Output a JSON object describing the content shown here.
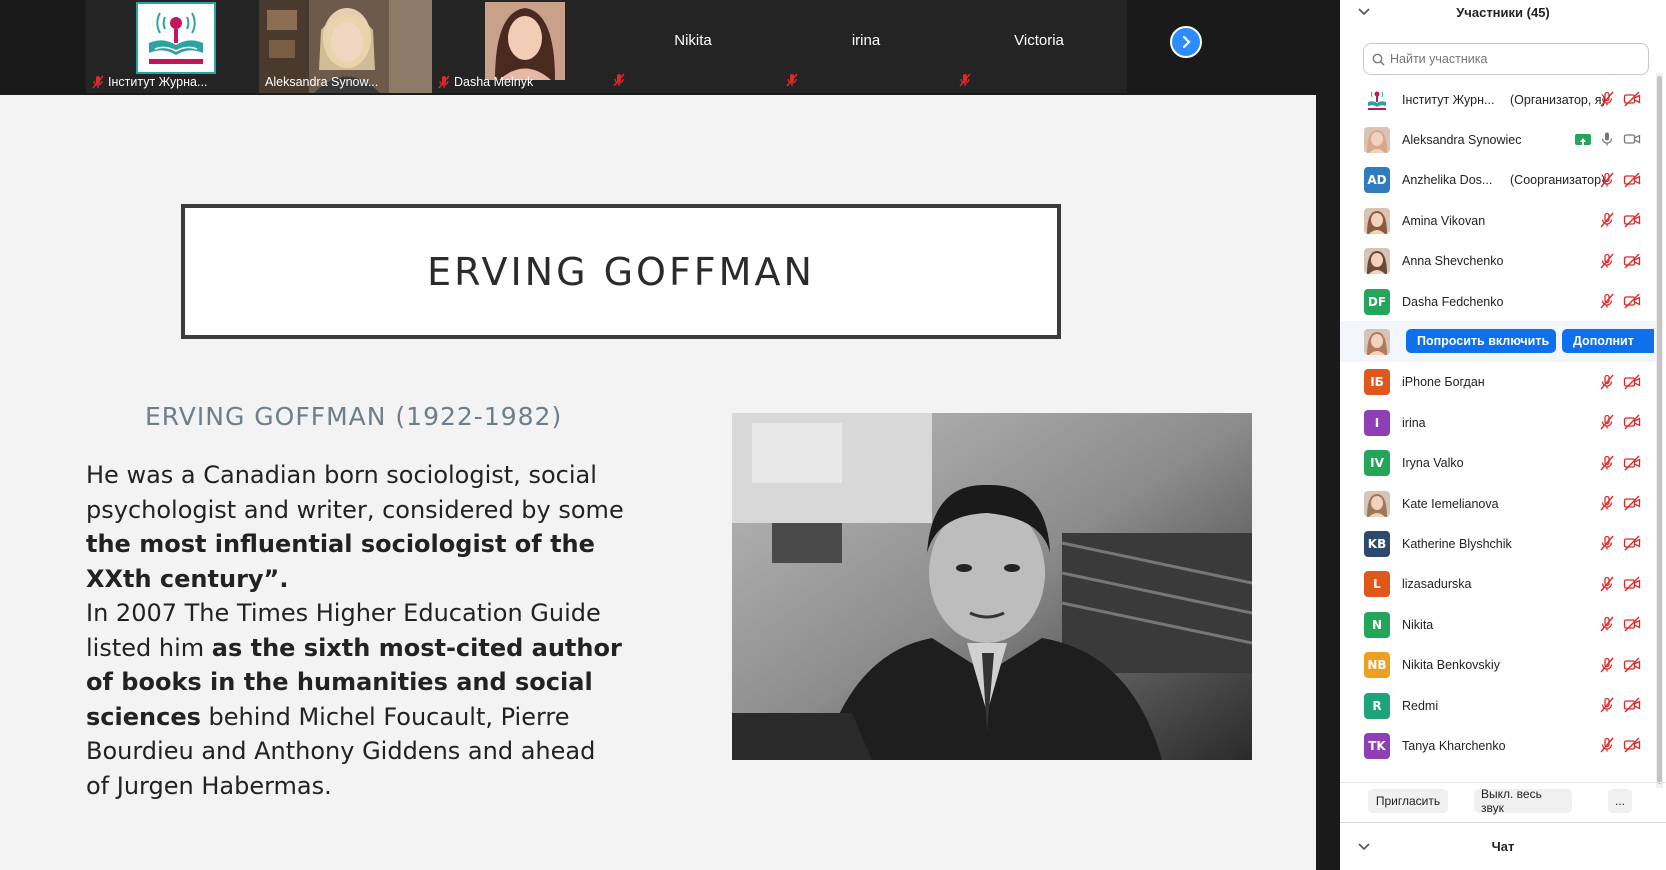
{
  "video_strip": {
    "tiles": [
      {
        "name": "Інститут Журна...",
        "muted": true
      },
      {
        "name": "Aleksandra Synow...",
        "muted": false,
        "active": true
      },
      {
        "name": "Dasha Melnyk",
        "muted": true
      },
      {
        "name": "Nikita",
        "muted": true
      },
      {
        "name": "irina",
        "muted": true
      },
      {
        "name": "Victoria",
        "muted": true
      }
    ],
    "logo_text": "ІНСТИТУТ ЖУРНАЛІСТИКИ"
  },
  "slide": {
    "title": "ERVING GOFFMAN",
    "subtitle": "ERVING GOFFMAN (1922-1982)",
    "p1_normal": "He was a Canadian born sociologist, social psychologist and writer, considered by some ",
    "p1_bold": "the most influential sociologist of the XXth century”.",
    "p2_normal_a": "In 2007 The Times Higher Education Guide listed him ",
    "p2_bold": "as the sixth most-cited author of books in the humanities and social sciences",
    "p2_normal_b": " behind Michel Foucault, Pierre Bourdieu and Anthony Giddens and ahead of Jurgen Habermas."
  },
  "participants_panel": {
    "title": "Участники (45)",
    "search_placeholder": "Найти участника",
    "participants": [
      {
        "name": "Інститут Журн...",
        "role": "(Организатор, я)",
        "initials": "",
        "color": "#ffffff",
        "kind": "logo"
      },
      {
        "name": "Aleksandra Synowiec",
        "role": "",
        "initials": "",
        "color": "#d9a88a",
        "kind": "photo"
      },
      {
        "name": "Anzhelika Dos...",
        "role": "(Соорганизатор)",
        "initials": "AD",
        "color": "#2e7bbf",
        "kind": "initials"
      },
      {
        "name": "Amina Vikovan",
        "role": "",
        "initials": "",
        "color": "#8a5a3c",
        "kind": "photo"
      },
      {
        "name": "Anna Shevchenko",
        "role": "",
        "initials": "",
        "color": "#6b4a3a",
        "kind": "photo"
      },
      {
        "name": "Dasha Fedchenko",
        "role": "",
        "initials": "DF",
        "color": "#23a55a",
        "kind": "initials"
      },
      {
        "name": "",
        "role": "",
        "initials": "",
        "color": "#b07a5e",
        "kind": "photo"
      },
      {
        "name": "iPhone Богдан",
        "role": "",
        "initials": "IБ",
        "color": "#e0571b",
        "kind": "initials"
      },
      {
        "name": "irina",
        "role": "",
        "initials": "I",
        "color": "#8e3fb5",
        "kind": "initials"
      },
      {
        "name": "Iryna Valko",
        "role": "",
        "initials": "IV",
        "color": "#23a55a",
        "kind": "initials"
      },
      {
        "name": "Kate Iemelianova",
        "role": "",
        "initials": "",
        "color": "#9a7a5a",
        "kind": "photo"
      },
      {
        "name": "Katherine Blyshchik",
        "role": "",
        "initials": "KB",
        "color": "#2c4a6e",
        "kind": "initials"
      },
      {
        "name": "lizasadurska",
        "role": "",
        "initials": "L",
        "color": "#e0571b",
        "kind": "initials"
      },
      {
        "name": "Nikita",
        "role": "",
        "initials": "N",
        "color": "#23a55a",
        "kind": "initials"
      },
      {
        "name": "Nikita Benkovskiy",
        "role": "",
        "initials": "NB",
        "color": "#f0a020",
        "kind": "initials"
      },
      {
        "name": "Redmi",
        "role": "",
        "initials": "R",
        "color": "#1fa37a",
        "kind": "initials"
      },
      {
        "name": "Tanya Kharchenko",
        "role": "",
        "initials": "TK",
        "color": "#8e3fb5",
        "kind": "initials"
      }
    ],
    "ask_unmute_label": "Попросить включить",
    "more_label": "Дополнит",
    "footer": {
      "invite": "Пригласить",
      "mute_all": "Выкл. весь звук",
      "more": "..."
    },
    "chat_title": "Чат"
  },
  "colors": {
    "accent": "#0e71eb",
    "muted_red": "#e02828",
    "active_speaker": "#8bc34a",
    "share_green": "#23a55a"
  }
}
